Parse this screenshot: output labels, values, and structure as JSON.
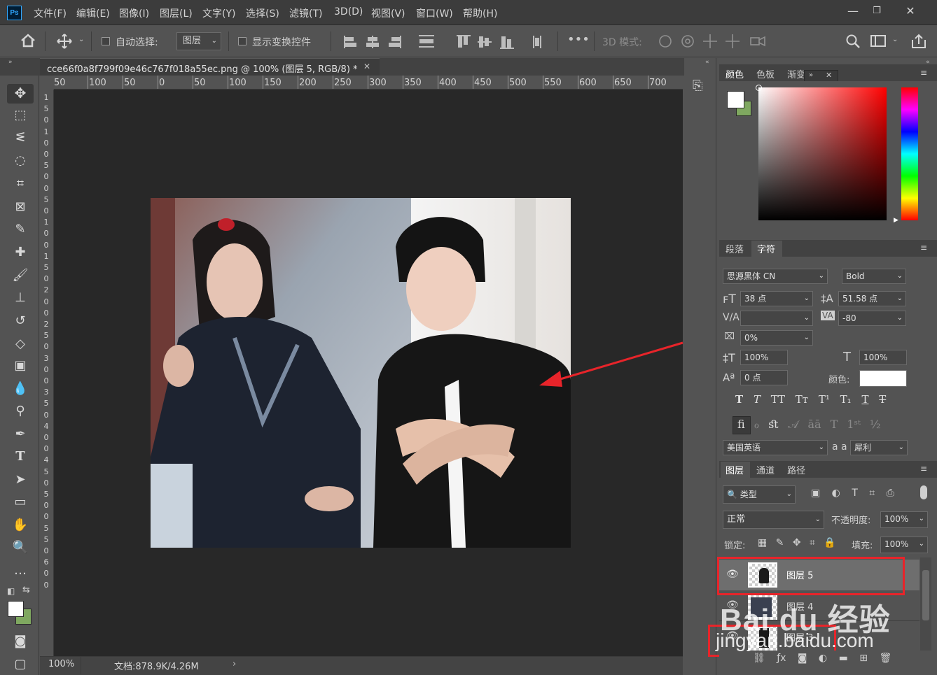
{
  "menubar": {
    "items": [
      "文件(F)",
      "编辑(E)",
      "图像(I)",
      "图层(L)",
      "文字(Y)",
      "选择(S)",
      "滤镜(T)",
      "3D(D)",
      "视图(V)",
      "窗口(W)",
      "帮助(H)"
    ],
    "minimize": "—",
    "restore": "❐",
    "close": "✕",
    "logo": "Ps"
  },
  "options": {
    "auto_select_label": "自动选择:",
    "auto_select_value": "图层",
    "show_transform_label": "显示变换控件",
    "mode_3d_label": "3D 模式:"
  },
  "document": {
    "tab_title": "cce66f0a8f799f09e46c767f018a55ec.png @ 100% (图层 5, RGB/8) *",
    "tab_close": "✕",
    "zoom": "100%",
    "doc_info": "文档:878.9K/4.26M"
  },
  "ruler": {
    "top": [
      "50",
      "100",
      "50",
      "0",
      "50",
      "100",
      "150",
      "200",
      "250",
      "300",
      "350",
      "400",
      "450",
      "500",
      "550",
      "600",
      "650",
      "700"
    ],
    "left": [
      "1",
      "5",
      "0",
      "1",
      "0",
      "0",
      "5",
      "0",
      "0",
      "5",
      "0",
      "1",
      "0",
      "0",
      "1",
      "5",
      "0",
      "2",
      "0",
      "0",
      "2",
      "5",
      "0",
      "3",
      "0",
      "0",
      "3",
      "5",
      "0",
      "4",
      "0",
      "0",
      "4",
      "5",
      "0",
      "5",
      "0",
      "0",
      "5",
      "5",
      "0",
      "6",
      "0",
      "0"
    ]
  },
  "color_panel": {
    "tabs": [
      "颜色",
      "色板",
      "渐变"
    ],
    "active": "颜色",
    "fg": "#ffffff",
    "bg": "#7fa860"
  },
  "char_panel": {
    "tabs": [
      "段落",
      "字符"
    ],
    "active": "字符",
    "font_family": "思源黑体 CN",
    "font_style": "Bold",
    "font_size": "38 点",
    "leading": "51.58 点",
    "kerning": "",
    "tracking": "-80",
    "tsume": "0%",
    "vscale": "100%",
    "hscale": "100%",
    "baseline": "0 点",
    "color_label": "颜色:",
    "language": "美国英语",
    "antialias": "犀利",
    "aa_label": "a a"
  },
  "layers_panel": {
    "tabs": [
      "图层",
      "通道",
      "路径"
    ],
    "active": "图层",
    "filter_label": "类型",
    "blend_mode": "正常",
    "opacity_label": "不透明度:",
    "opacity": "100%",
    "lock_label": "锁定:",
    "fill_label": "填充:",
    "fill": "100%",
    "layers": [
      {
        "name": "图层 5",
        "selected": true
      },
      {
        "name": "图层 4",
        "selected": false
      },
      {
        "name": "图层 3",
        "selected": false
      }
    ]
  },
  "watermark": {
    "line1": "Bai du 经验",
    "line2": "jingyan.baidu.com"
  },
  "colors": {
    "accent_red": "#e8242a",
    "app_bg": "#535353",
    "canvas_bg": "#282828"
  }
}
